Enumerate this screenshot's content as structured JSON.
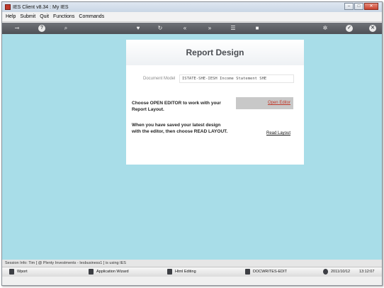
{
  "window": {
    "title": "IES Client v8.34 : My IES",
    "controls": {
      "minimize": "–",
      "maximize": "□",
      "close": "✕"
    }
  },
  "menu": [
    "Help",
    "Submit",
    "Quit",
    "Functions",
    "Commands"
  ],
  "toolbar": {
    "icons": [
      "key-icon",
      "help-icon",
      "search-icon",
      "heart-icon",
      "history-icon",
      "back-icon",
      "forward-icon",
      "list-icon",
      "stop-icon",
      "settings-icon",
      "check-icon",
      "close-icon"
    ]
  },
  "panel": {
    "title": "Report Design",
    "doc_model_label": "Document Model",
    "doc_model_value": "ISTATE-SHE-IESH Income Statement SHE",
    "instruction_open": "Choose OPEN EDITOR to work with your Report Layout.",
    "instruction_read": "When you have saved your latest design with the editor, then choose READ LAYOUT.",
    "open_editor": "Open Editor",
    "read_layout": "Read Layout"
  },
  "status": {
    "session_info": "Session Info: Tim [ @ Plenty Investments  - Iesbusiness1 ] is using IES"
  },
  "taskbar": {
    "items": [
      "Wport",
      "Application Wizard",
      "Html Editing",
      "DOCWRITES-EDIT"
    ],
    "date": "2011/10/12",
    "time": "13:12:07"
  },
  "colors": {
    "background": "#a8dde8",
    "toolbar": "#5e6167",
    "accent_link": "#c0392b"
  }
}
